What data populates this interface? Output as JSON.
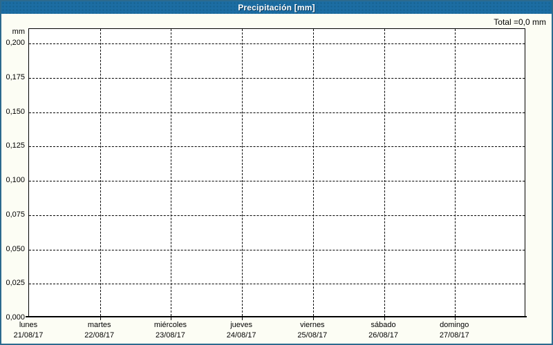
{
  "window": {
    "title": "Precipitación [mm]"
  },
  "summary": {
    "total_label": "Total =0,0 mm"
  },
  "axes": {
    "unit_label": "mm",
    "y_ticks": [
      "0,200",
      "0,175",
      "0,150",
      "0,125",
      "0,100",
      "0,075",
      "0,050",
      "0,025",
      "0,000"
    ],
    "x_ticks": [
      {
        "day": "lunes",
        "date": "21/08/17"
      },
      {
        "day": "martes",
        "date": "22/08/17"
      },
      {
        "day": "miércoles",
        "date": "23/08/17"
      },
      {
        "day": "jueves",
        "date": "24/08/17"
      },
      {
        "day": "viernes",
        "date": "25/08/17"
      },
      {
        "day": "sábado",
        "date": "26/08/17"
      },
      {
        "day": "domingo",
        "date": "27/08/17"
      }
    ]
  },
  "colors": {
    "header_bg": "#1c6da3",
    "frame_border": "#2c6a8e",
    "grid": "#000000",
    "title_text": "#ffffff",
    "plot_bg": "#ffffff",
    "page_bg": "#fcfdf4"
  },
  "chart_data": {
    "type": "bar",
    "title": "Precipitación [mm]",
    "categories": [
      "lunes 21/08/17",
      "martes 22/08/17",
      "miércoles 23/08/17",
      "jueves 24/08/17",
      "viernes 25/08/17",
      "sábado 26/08/17",
      "domingo 27/08/17"
    ],
    "values": [
      0,
      0,
      0,
      0,
      0,
      0,
      0
    ],
    "total": "0,0 mm",
    "xlabel": "",
    "ylabel": "mm",
    "ylim": [
      0,
      0.2105
    ],
    "y_tick_step": 0.025,
    "grid": "dashed",
    "legend": "none"
  }
}
